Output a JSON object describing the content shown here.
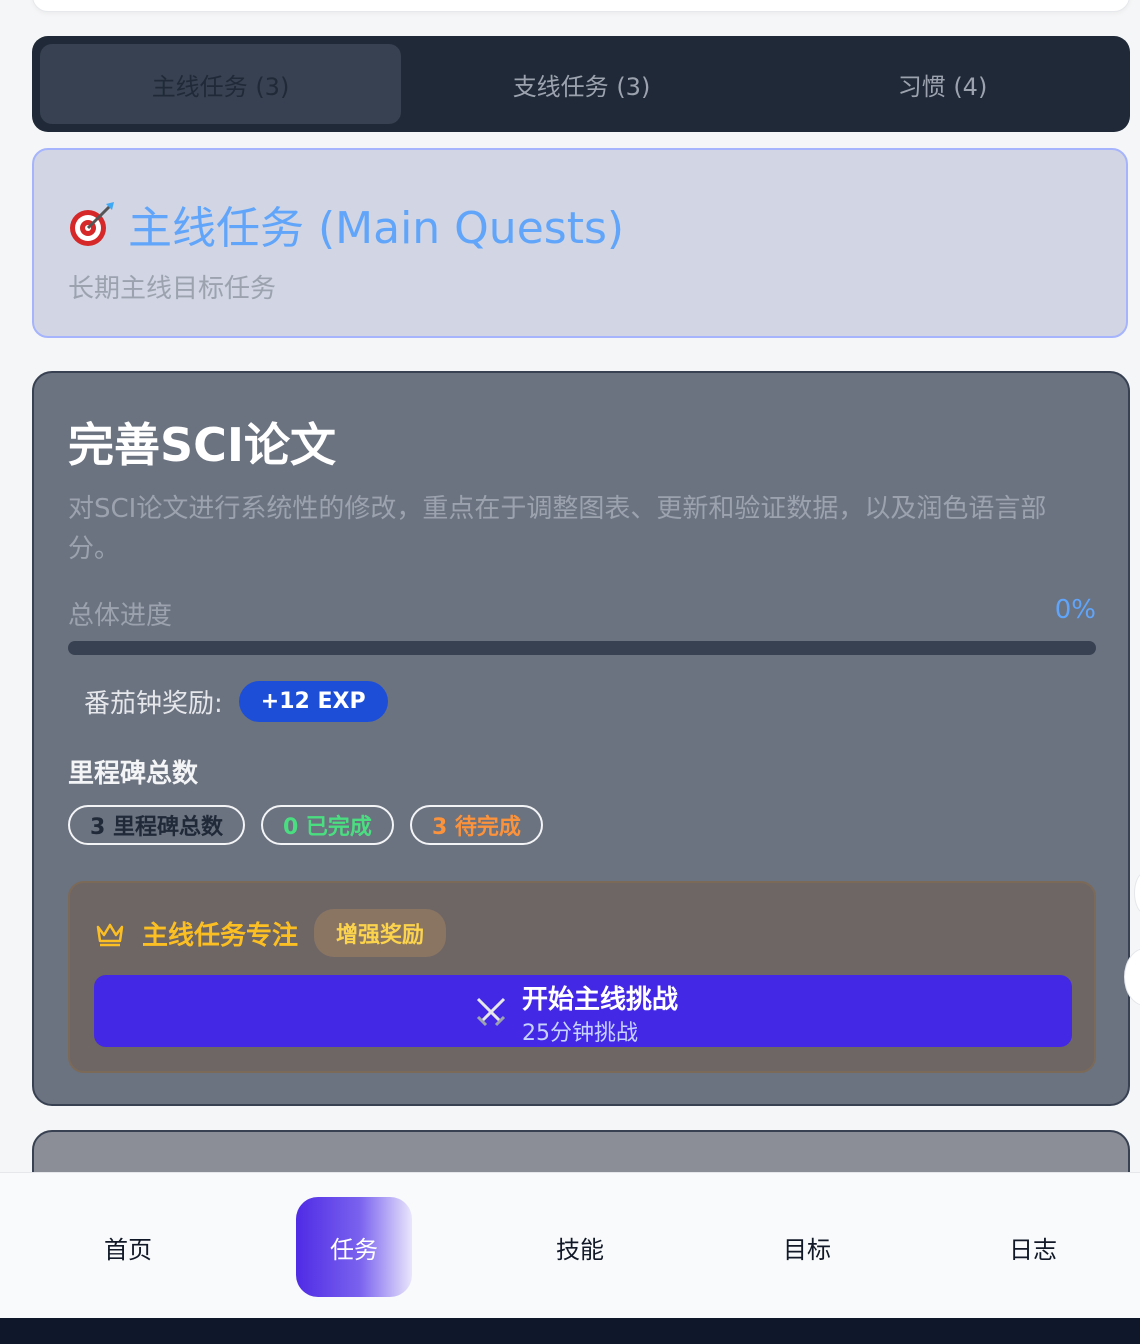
{
  "tabs": [
    {
      "label": "主线任务 (3)",
      "active": true
    },
    {
      "label": "支线任务 (3)",
      "active": false
    },
    {
      "label": "习惯 (4)",
      "active": false
    }
  ],
  "section": {
    "icon": "target-icon",
    "title": "主线任务 (Main Quests)",
    "subtitle": "长期主线目标任务"
  },
  "quest": {
    "title": "完善SCI论文",
    "description": "对SCI论文进行系统性的修改，重点在于调整图表、更新和验证数据，以及润色语言部分。",
    "progress_label": "总体进度",
    "progress_text": "0%",
    "progress_value": 0,
    "reward_label": "番茄钟奖励:",
    "reward_badge": "+12 EXP",
    "milestone_heading": "里程碑总数",
    "chips": {
      "total": "3 里程碑总数",
      "done": "0 已完成",
      "pending": "3 待完成"
    },
    "focus": {
      "icon": "crown-icon",
      "title": "主线任务专注",
      "badge": "增强奖励",
      "button_icon": "swords-icon",
      "button_label": "开始主线挑战",
      "button_sub": "25分钟挑战"
    }
  },
  "nav": [
    {
      "label": "首页",
      "active": false
    },
    {
      "label": "任务",
      "active": true
    },
    {
      "label": "技能",
      "active": false
    },
    {
      "label": "目标",
      "active": false
    },
    {
      "label": "日志",
      "active": false
    }
  ],
  "colors": {
    "accent_blue": "#60a5fa",
    "exp_badge": "#1d4ed8",
    "start_button": "#4328e6",
    "tab_bar": "#1f2937"
  }
}
